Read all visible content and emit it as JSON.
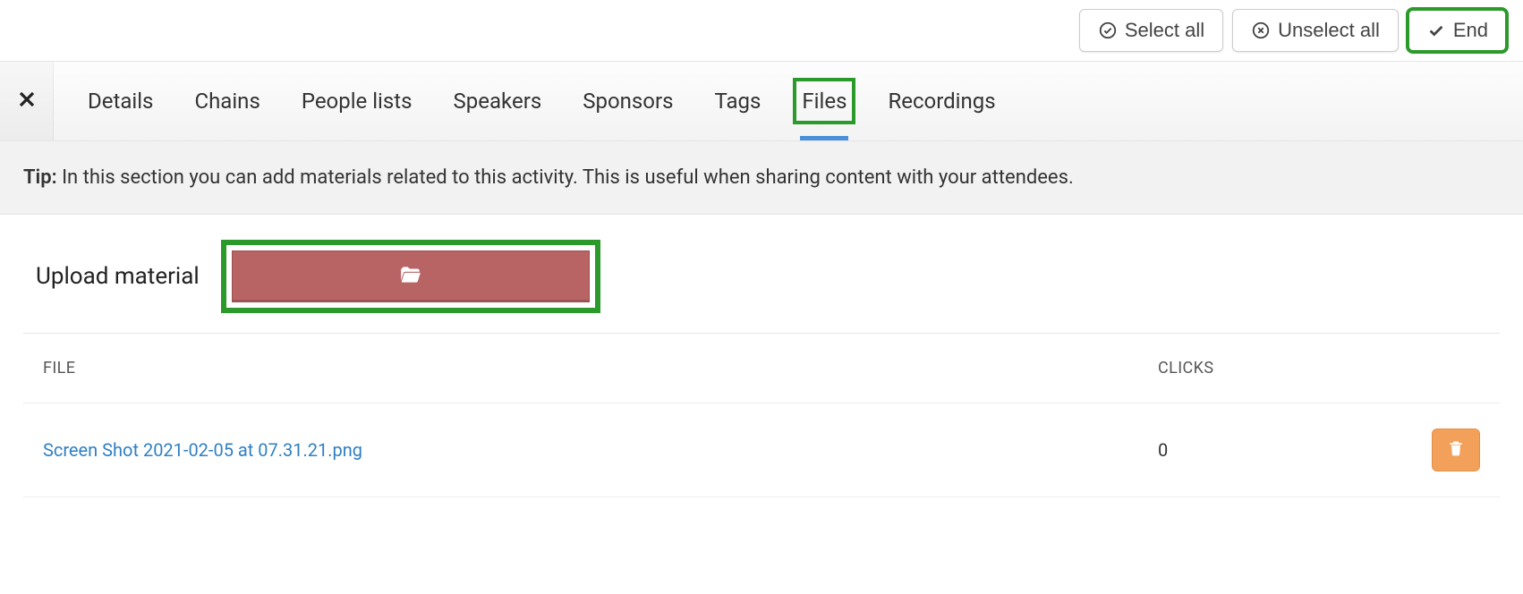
{
  "toolbar": {
    "select_all": "Select all",
    "unselect_all": "Unselect all",
    "end": "End"
  },
  "tabs": {
    "items": [
      "Details",
      "Chains",
      "People lists",
      "Speakers",
      "Sponsors",
      "Tags",
      "Files",
      "Recordings"
    ],
    "active_index": 6
  },
  "tip": {
    "label": "Tip:",
    "text": "In this section you can add materials related to this activity. This is useful when sharing content with your attendees."
  },
  "upload": {
    "label": "Upload material"
  },
  "table": {
    "headers": {
      "file": "FILE",
      "clicks": "CLICKS"
    },
    "rows": [
      {
        "file": "Screen Shot 2021-02-05 at 07.31.21.png",
        "clicks": "0"
      }
    ]
  }
}
